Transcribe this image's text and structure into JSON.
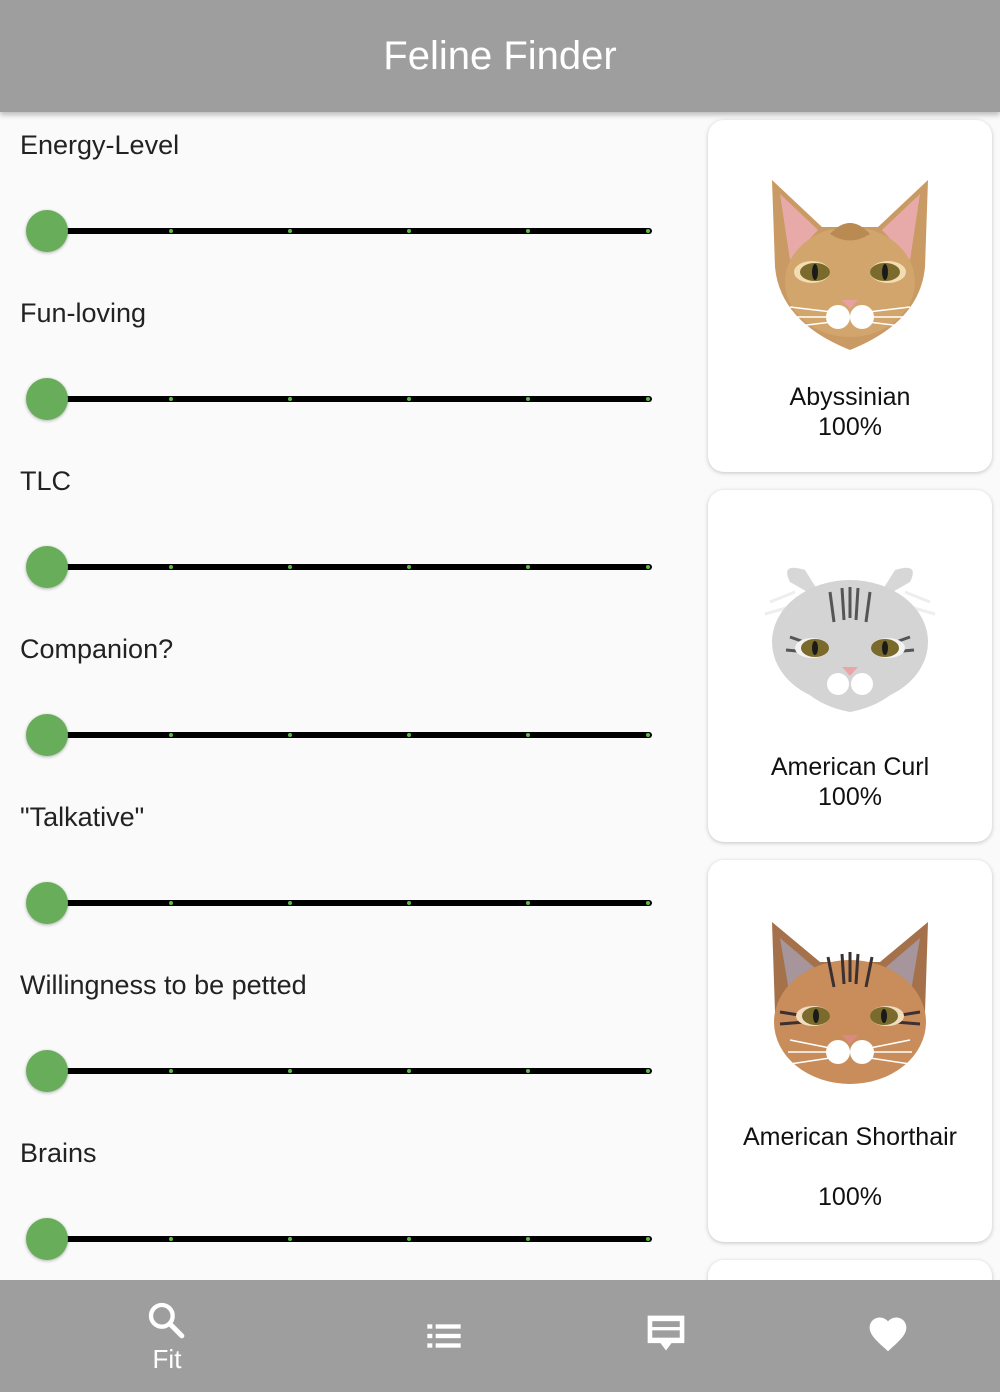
{
  "app": {
    "title": "Feline Finder"
  },
  "sliders": [
    {
      "label": "Energy-Level",
      "value": 0
    },
    {
      "label": "Fun-loving",
      "value": 0
    },
    {
      "label": "TLC",
      "value": 0
    },
    {
      "label": "Companion?",
      "value": 0
    },
    {
      "label": "\"Talkative\"",
      "value": 0
    },
    {
      "label": "Willingness to be petted",
      "value": 0
    },
    {
      "label": "Brains",
      "value": 0
    }
  ],
  "breeds": [
    {
      "name": "Abyssinian",
      "match": "100%"
    },
    {
      "name": "American Curl",
      "match": "100%"
    },
    {
      "name": "American Shorthair",
      "match": "100%"
    }
  ],
  "nav": {
    "fit_label": "Fit",
    "items": [
      "search-icon",
      "list-icon",
      "chat-icon",
      "heart-icon"
    ]
  },
  "colors": {
    "bar": "#9e9e9e",
    "slider_thumb": "#68ad5a",
    "track": "#000000"
  }
}
